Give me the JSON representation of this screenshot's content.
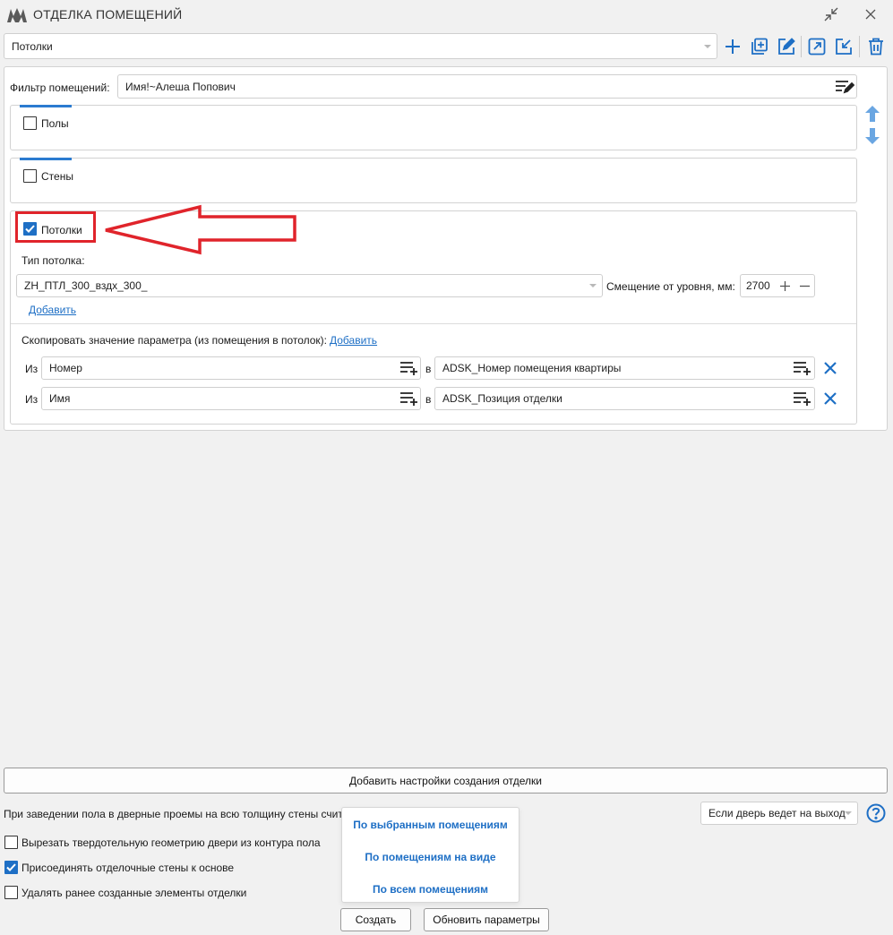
{
  "window": {
    "title": "ОТДЕЛКА ПОМЕЩЕНИЙ"
  },
  "profile": {
    "selected": "Потолки"
  },
  "filter": {
    "label": "Фильтр помещений:",
    "value": "Имя!~Алеша Попович"
  },
  "sections": {
    "floors": {
      "label": "Полы",
      "checked": false
    },
    "walls": {
      "label": "Стены",
      "checked": false
    },
    "ceilings": {
      "label": "Потолки",
      "checked": true,
      "type_label": "Тип потолка:",
      "type_value": "ZH_ПТЛ_300_вздх_300_",
      "offset_label": "Смещение от уровня, мм:",
      "offset_value": "2700",
      "add_link": "Добавить",
      "copy_label": "Скопировать значение параметра (из помещения в потолок):",
      "copy_add_link": "Добавить",
      "rows": [
        {
          "from_label": "Из",
          "from_value": "Номер",
          "to_label": "в",
          "to_value": "ADSK_Номер помещения квартиры"
        },
        {
          "from_label": "Из",
          "from_value": "Имя",
          "to_label": "в",
          "to_value": "ADSK_Позиция отделки"
        }
      ]
    }
  },
  "add_settings_button": "Добавить настройки создания отделки",
  "options": {
    "door_text": "При заведении пола в дверные проемы на всю толщину стены считать",
    "door_select": "Если дверь ведет на выход",
    "cut_door": {
      "label": "Вырезать твердотельную геометрию двери из контура пола",
      "checked": false
    },
    "join_walls": {
      "label": "Присоединять отделочные стены к основе",
      "checked": true
    },
    "delete_old": {
      "label": "Удалять ранее созданные элементы отделки",
      "checked": false
    }
  },
  "create_menu": [
    "По выбранным помещениям",
    "По помещениям на виде",
    "По всем помещениям"
  ],
  "create_button": "Создать",
  "update_button": "Обновить параметры",
  "colors": {
    "accent": "#1e6fc5",
    "highlight": "#e0242b"
  }
}
